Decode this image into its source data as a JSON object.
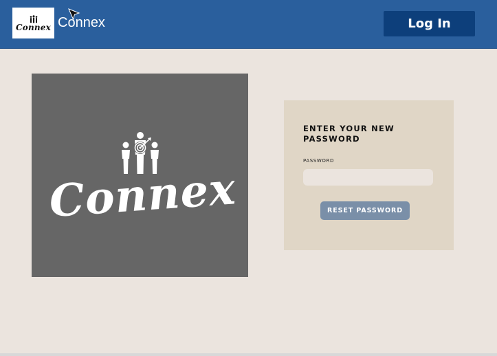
{
  "header": {
    "logo_text": "Connex",
    "brand_name": "Connex",
    "login_label": "Log In"
  },
  "hero": {
    "logo_text": "Connex"
  },
  "reset_form": {
    "title": "ENTER YOUR NEW PASSWORD",
    "password_label": "PASSWORD",
    "password_value": "",
    "password_placeholder": "",
    "submit_label": "RESET PASSWORD"
  },
  "icons": {
    "logo_mark": "people-target-icon",
    "cursor": "mouse-cursor-icon"
  },
  "colors": {
    "header_bg": "#2a5f9d",
    "login_button_bg": "#0d3f7b",
    "page_bg": "#ebe4de",
    "hero_bg": "#666666",
    "card_bg": "#e0d6c6",
    "reset_button_bg": "#7a8fa8"
  }
}
